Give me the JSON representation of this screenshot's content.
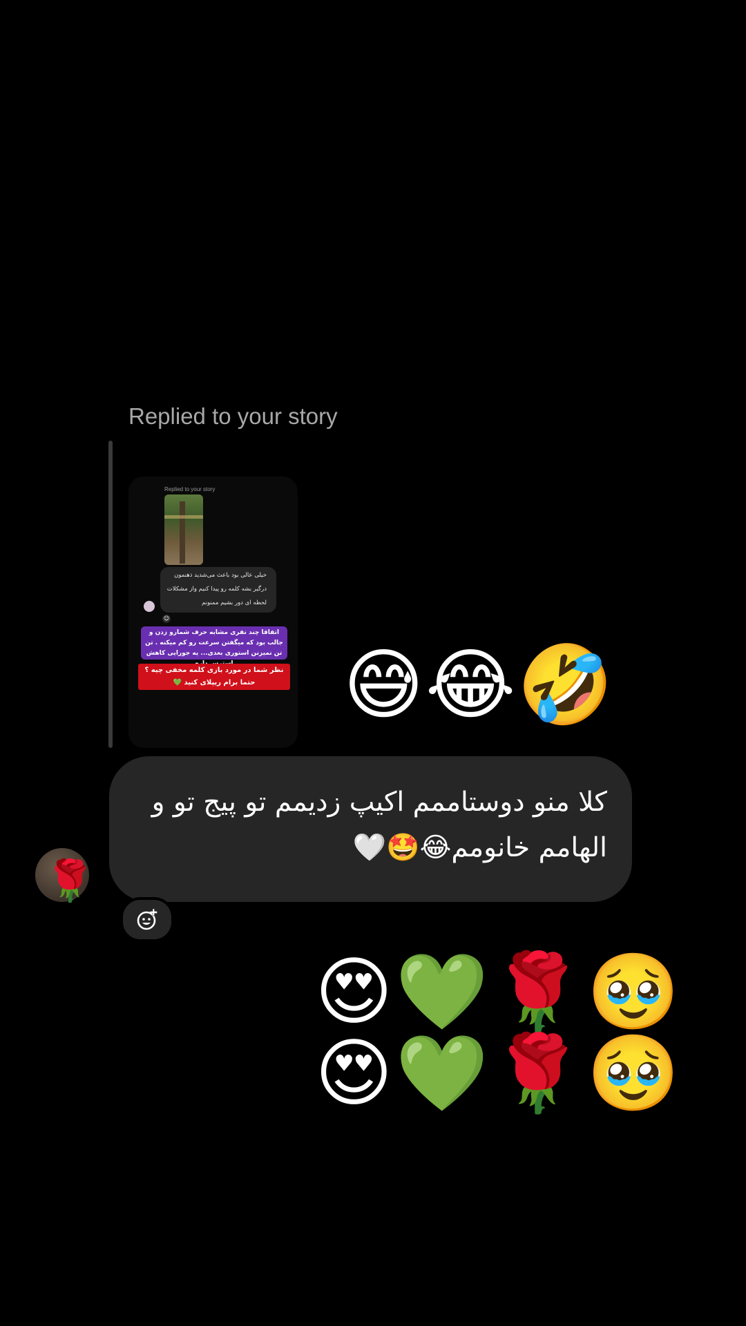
{
  "story_reply": {
    "label": "Replied to your story",
    "thumbnail": {
      "inner_label": "Replied to your story",
      "inner_message": "خیلی عالی بود باعث می‌شدید ذهنمون درگیر بشه کلمه رو پیدا کنیم واز مشکلات لحظه ای دور بشیم ممنونم",
      "purple_caption": "اتفاقا چند نفری مشابه حرف شمارو زدن و جالب بود که میگفتن سرعت رو کم میکنه . تن تن نمیزنن استوری بعدی... یه جورایی کاهش استرس داره",
      "red_caption": "نظر شما در مورد بازی کلمه مخفی چیه ؟ حتما برام ریپلای کنید 💚"
    }
  },
  "reaction_emojis": "😅😂🤣",
  "message": {
    "text": "کلا منو دوستاممم اکیپ زدیمم تو پیج تو و الهامم خانومم😂🤩🤍"
  },
  "sender_avatar": {
    "emoji": "🌹"
  },
  "add_reaction_icon": "add-reaction-icon",
  "emoji_grid": {
    "row1": "😍💚🌹🥹",
    "row2": "😍💚🌹🥹"
  }
}
